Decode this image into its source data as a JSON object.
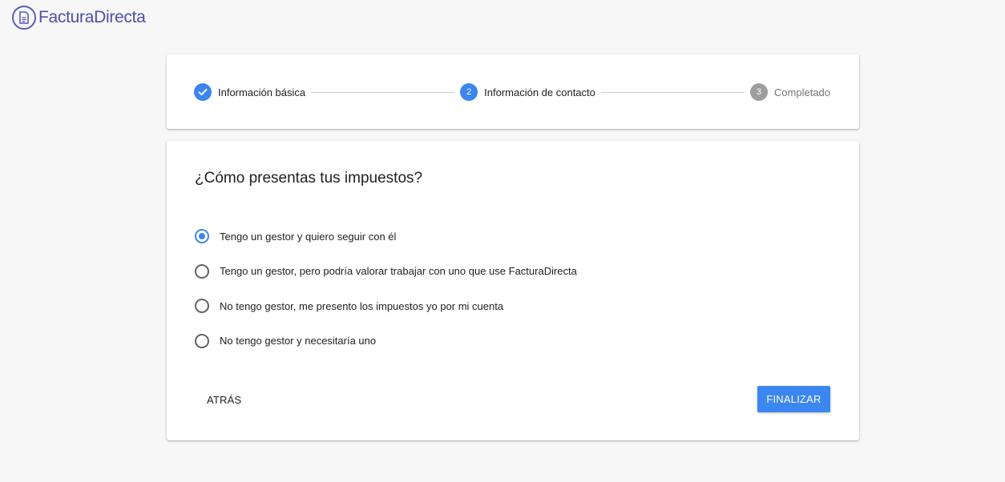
{
  "brand": {
    "name": "FacturaDirecta",
    "icon": "document-icon",
    "color": "#4a50a8"
  },
  "stepper": {
    "steps": [
      {
        "label": "Información básica",
        "number": "",
        "state": "completed",
        "icon": "check-icon"
      },
      {
        "label": "Información de contacto",
        "number": "2",
        "state": "active"
      },
      {
        "label": "Completado",
        "number": "3",
        "state": "inactive"
      }
    ]
  },
  "form": {
    "question": "¿Cómo presentas tus impuestos?",
    "options": [
      {
        "label": "Tengo un gestor y quiero seguir con él",
        "selected": true
      },
      {
        "label": "Tengo un gestor, pero podría valorar trabajar con uno que use FacturaDirecta",
        "selected": false
      },
      {
        "label": "No tengo gestor, me presento los impuestos yo por mi cuenta",
        "selected": false
      },
      {
        "label": "No tengo gestor y necesitaría uno",
        "selected": false
      }
    ],
    "back_label": "ATRÁS",
    "finish_label": "FINALIZAR"
  },
  "colors": {
    "accent": "#3b86f0",
    "inactive": "#9e9e9e"
  }
}
